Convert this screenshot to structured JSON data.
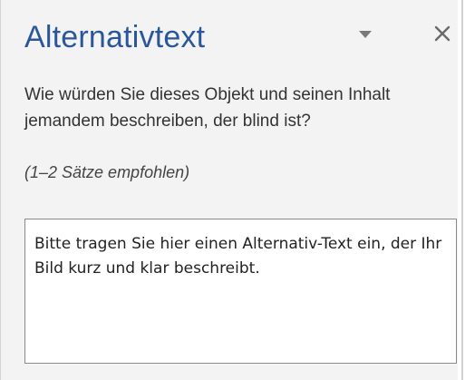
{
  "pane": {
    "title": "Alternativtext",
    "question": "Wie würden Sie dieses Objekt und seinen Inhalt jemandem beschreiben, der blind ist?",
    "hint": "(1–2 Sätze empfohlen)",
    "alt_text_value": "Bitte tragen Sie hier einen Alternativ-Text ein, der Ihr Bild kurz und klar beschreibt."
  },
  "icons": {
    "menu": "chevron-down-icon",
    "close": "close-icon"
  },
  "colors": {
    "title": "#2b579a",
    "pane_background": "#f3f3f3",
    "text": "#333333"
  }
}
